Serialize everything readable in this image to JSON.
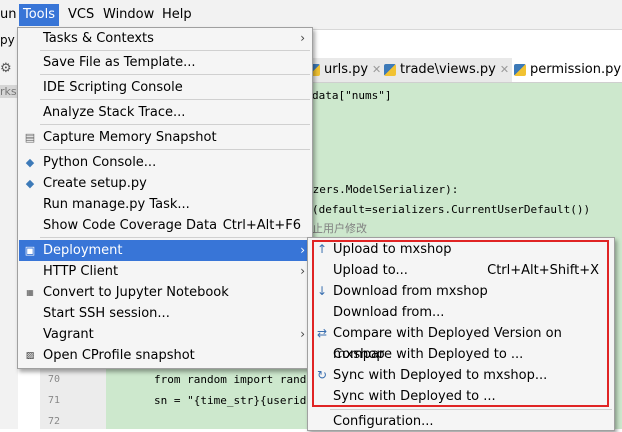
{
  "menubar": {
    "items": [
      "un",
      "Tools",
      "VCS",
      "Window",
      "Help"
    ]
  },
  "background": {
    "left_fragments": [
      "py",
      "rks"
    ],
    "tabs": [
      {
        "label": "urls.py"
      },
      {
        "label": "trade\\views.py"
      },
      {
        "label": "permission.py"
      }
    ],
    "code_lines": [
      {
        "text": "data[\"nums\"]"
      },
      {
        "text": "izers.ModelSerializer):"
      },
      {
        "text": "(default=serializers.CurrentUserDefault())"
      },
      {
        "text": "止用户修改"
      },
      {
        "text": "from random import randi"
      },
      {
        "text": "sn = \"{time_str}{userid"
      }
    ],
    "line_numbers": [
      "70",
      "71",
      "72"
    ]
  },
  "tools_menu": {
    "items": [
      {
        "label": "Tasks & Contexts",
        "submenu": true
      },
      {
        "label": "Save File as Template..."
      },
      {
        "label": "IDE Scripting Console"
      },
      {
        "label": "Analyze Stack Trace..."
      },
      {
        "label": "Capture Memory Snapshot",
        "icon": "memory-snapshot-icon"
      },
      {
        "label": "Python Console...",
        "icon": "python-console-icon"
      },
      {
        "label": "Create setup.py",
        "icon": "python-file-icon"
      },
      {
        "label": "Run manage.py Task..."
      },
      {
        "label": "Show Code Coverage Data",
        "shortcut": "Ctrl+Alt+F6"
      },
      {
        "label": "Deployment",
        "submenu": true,
        "highlighted": true
      },
      {
        "label": "HTTP Client",
        "submenu": true
      },
      {
        "label": "Convert to Jupyter Notebook",
        "icon": "jupyter-icon"
      },
      {
        "label": "Start SSH session..."
      },
      {
        "label": "Vagrant",
        "submenu": true
      },
      {
        "label": "Open CProfile snapshot",
        "icon": "cprofile-icon"
      }
    ]
  },
  "deployment_submenu": {
    "items": [
      {
        "label": "Upload to mxshop",
        "icon": "upload-icon"
      },
      {
        "label": "Upload to...",
        "shortcut": "Ctrl+Alt+Shift+X"
      },
      {
        "label": "Download from mxshop",
        "icon": "download-icon"
      },
      {
        "label": "Download from..."
      },
      {
        "label": "Compare with Deployed Version on mxshop",
        "icon": "compare-icon"
      },
      {
        "label": "Compare with Deployed to ..."
      },
      {
        "label": "Sync with Deployed to mxshop...",
        "icon": "sync-icon"
      },
      {
        "label": "Sync with Deployed to ..."
      },
      {
        "label": "Configuration..."
      }
    ]
  },
  "colors": {
    "highlight": "#3875d7",
    "annotation_box": "#e02424",
    "editor_bg": "#cde8cd"
  }
}
